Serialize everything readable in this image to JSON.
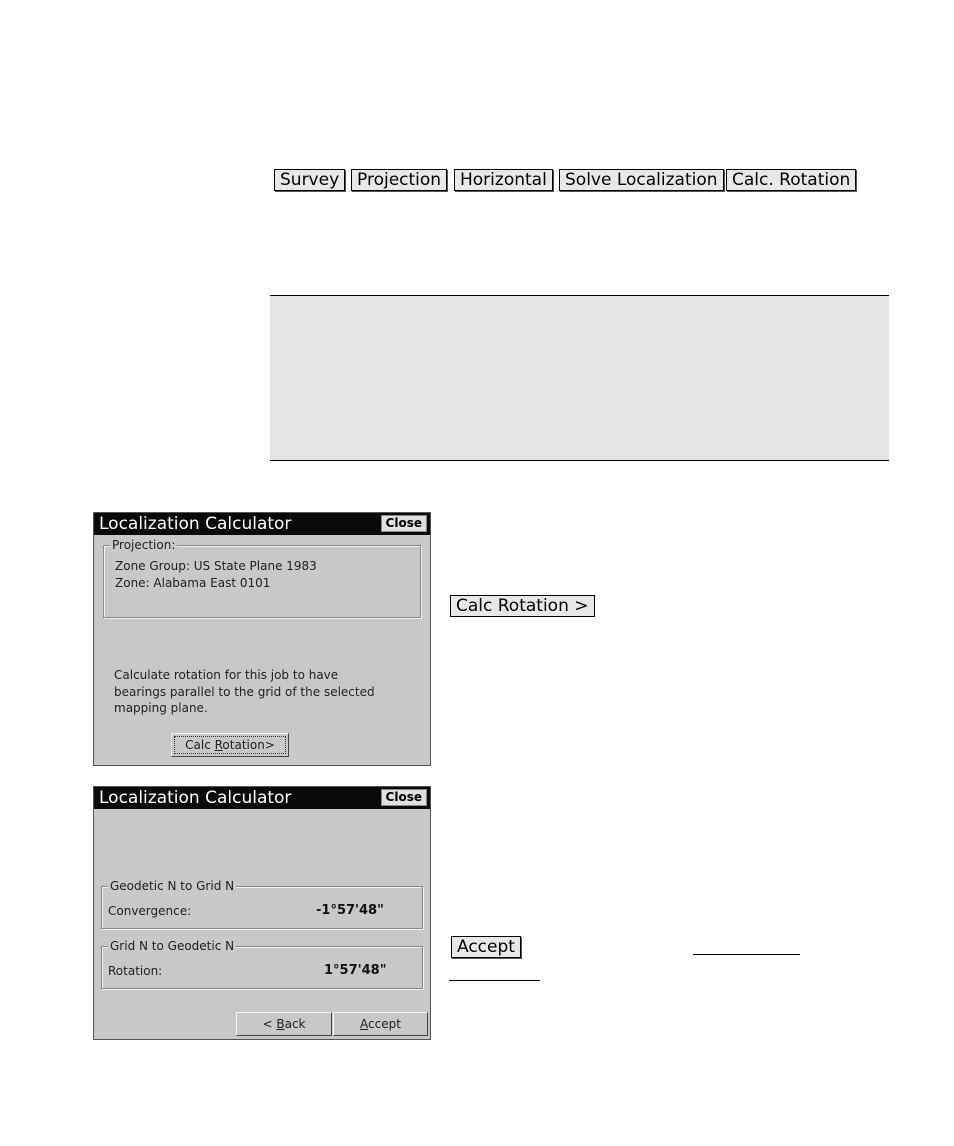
{
  "tabs": [
    {
      "label": "Survey"
    },
    {
      "label": "Projection"
    },
    {
      "label": "Horizontal"
    },
    {
      "label": "Solve Localization"
    },
    {
      "label": "Calc. Rotation"
    }
  ],
  "dialog1": {
    "title": "Localization Calculator",
    "close_label": "Close",
    "group_label": "Projection:",
    "zone_group": "Zone Group: US State Plane 1983",
    "zone": "Zone: Alabama East 0101",
    "description_lines": [
      "Calculate rotation for this job to have",
      "bearings parallel to the grid of the selected",
      "mapping plane."
    ],
    "calc_button": {
      "pre": "Calc ",
      "accel": "R",
      "post": "otation>"
    }
  },
  "side_buttons": {
    "calc_rotation": "Calc Rotation >",
    "accept": "Accept"
  },
  "dialog2": {
    "title": "Localization Calculator",
    "close_label": "Close",
    "group1_label": "Geodetic N to Grid N",
    "convergence_label": "Convergence:",
    "convergence_value": "-1°57'48\"",
    "group2_label": "Grid N to Geodetic N",
    "rotation_label": "Rotation:",
    "rotation_value": "1°57'48\"",
    "back_button": {
      "pre": "< ",
      "accel": "B",
      "post": "ack"
    },
    "accept_button": {
      "pre": "",
      "accel": "A",
      "post": "ccept"
    }
  }
}
